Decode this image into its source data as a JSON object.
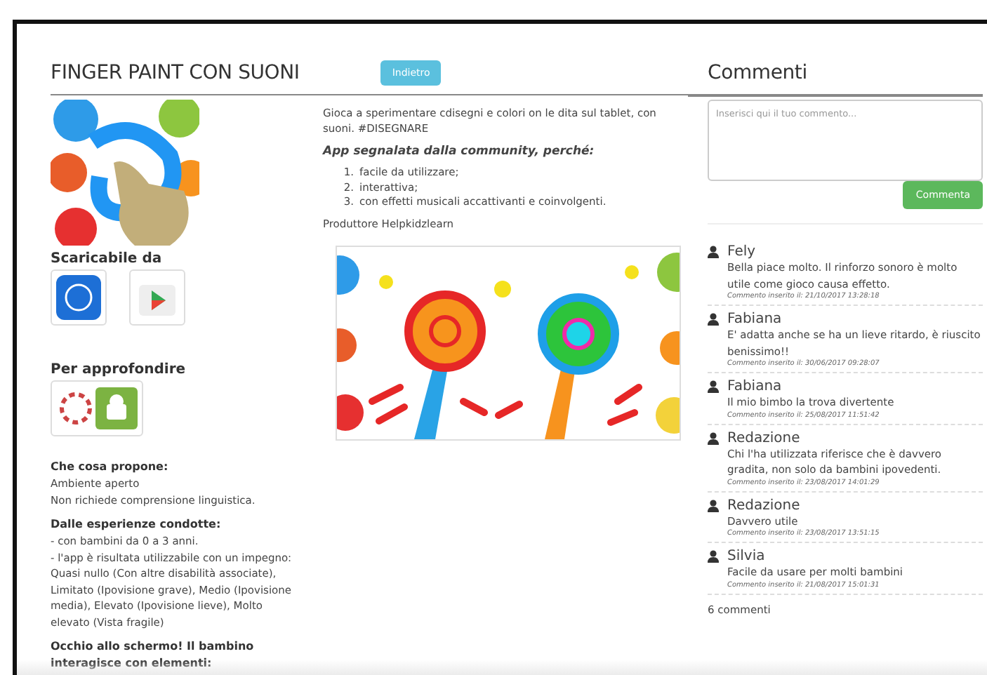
{
  "app": {
    "title": "FINGER PAINT CON SUONI",
    "back_button": "Indietro"
  },
  "sidebar": {
    "download_heading": "Scaricabile da",
    "more_heading": "Per approfondire",
    "sections": [
      {
        "heading": "Che cosa propone:",
        "lines": [
          "Ambiente aperto",
          "Non richiede comprensione linguistica."
        ]
      },
      {
        "heading": "Dalle esperienze condotte:",
        "lines": [
          "- con bambini da 0 a 3 anni.",
          "- l'app è risultata utilizzabile con un impegno: Quasi nullo (Con altre disabilità associate), Limitato (Ipovisione grave), Medio (Ipovisione media), Elevato (Ipovisione lieve), Molto elevato (Vista fragile)"
        ]
      },
      {
        "heading": "Occhio allo schermo! Il bambino interagisce con elementi:"
      }
    ]
  },
  "description": {
    "intro": "Gioca a sperimentare cdisegni e colori on le dita sul tablet, con suoni. #DISEGNARE",
    "reasons_heading": "App segnalata dalla community, perché:",
    "reasons": [
      {
        "marker": "1.",
        "text": "facile da utilizzare;"
      },
      {
        "marker": "2.",
        "text": "interattiva;"
      },
      {
        "marker": "3.",
        "text": "con effetti musicali accattivanti e coinvolgenti."
      }
    ],
    "producer": "Produttore Helpkidzlearn"
  },
  "comments": {
    "heading": "Commenti",
    "input": {
      "placeholder": "Inserisci qui il tuo commento..."
    },
    "submit_button": "Commenta",
    "items": [
      {
        "author": "Fely",
        "text": "Bella piace molto. Il rinforzo sonoro è molto utile come gioco causa effetto.",
        "date": "Commento inserito il: 21/10/2017 13:28:18"
      },
      {
        "author": "Fabiana",
        "text": "E' adatta anche se ha un lieve ritardo, è riuscito benissimo!!",
        "date": "Commento inserito il: 30/06/2017 09:28:07"
      },
      {
        "author": "Fabiana",
        "text": "Il mio bimbo la trova divertente",
        "date": "Commento inserito il: 25/08/2017 11:51:42"
      },
      {
        "author": "Redazione",
        "text": "Chi l'ha utilizzata riferisce che è davvero gradita, non solo da bambini ipovedenti.",
        "date": "Commento inserito il: 23/08/2017 14:01:29"
      },
      {
        "author": "Redazione",
        "text": "Davvero utile",
        "date": "Commento inserito il: 23/08/2017 13:51:15"
      },
      {
        "author": "Silvia",
        "text": "Facile da usare per molti bambini",
        "date": "Commento inserito il: 21/08/2017 15:01:31"
      }
    ],
    "count": "6 commenti"
  }
}
